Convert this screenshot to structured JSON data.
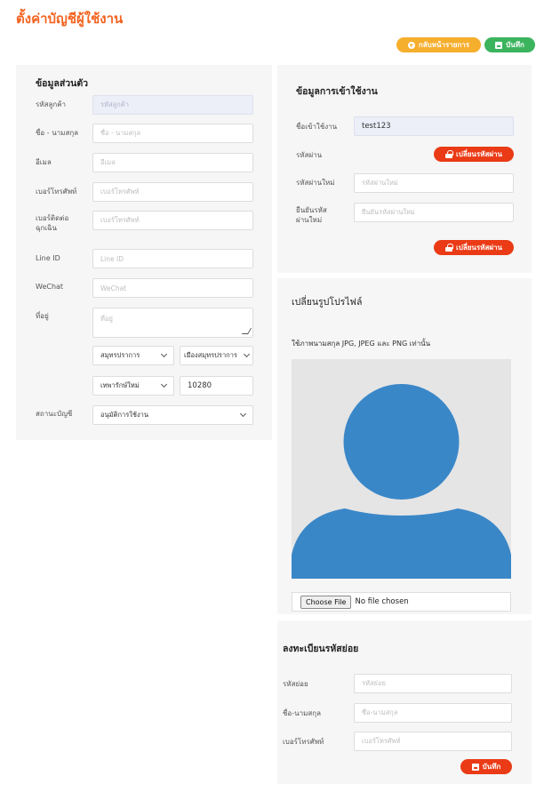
{
  "page": {
    "title": "ตั้งค่าบัญชีผู้ใช้งาน"
  },
  "toolbar": {
    "back_label": "กลับหน้ารายการ",
    "save_label": "บันทึก"
  },
  "personal": {
    "title": "ข้อมูลส่วนตัว",
    "customer_code": {
      "label": "รหัสลูกค้า",
      "placeholder": "รหัสลูกค้า"
    },
    "full_name": {
      "label": "ชื่อ - นามสกุล",
      "placeholder": "ชื่อ - นามสกุล"
    },
    "email": {
      "label": "อีเมล",
      "placeholder": "อีเมล"
    },
    "phone": {
      "label": "เบอร์โทรศัพท์",
      "placeholder": "เบอร์โทรศัพท์"
    },
    "emergency_phone": {
      "label_line1": "เบอร์ติดต่อ",
      "label_line2": "ฉุกเฉิน",
      "placeholder": "เบอร์โทรศัพท์"
    },
    "line_id": {
      "label": "Line ID",
      "placeholder": "Line ID"
    },
    "wechat": {
      "label": "WeChat",
      "placeholder": "WeChat"
    },
    "address": {
      "label": "ที่อยู่",
      "placeholder": "ที่อยู่",
      "province": "สมุทรปราการ",
      "district": "เมืองสมุทรปราการ",
      "subdistrict": "เทพารักษ์ใหม่",
      "postcode": "10280"
    },
    "account_status": {
      "label": "สถานะบัญชี",
      "value": "อนุมัติการใช้งาน"
    }
  },
  "login": {
    "title": "ข้อมูลการเข้าใช้งาน",
    "username": {
      "label": "ชื่อเข้าใช้งาน",
      "value": "test123"
    },
    "password": {
      "label": "รหัสผ่าน",
      "change_label": "เปลี่ยนรหัสผ่าน"
    },
    "new_password": {
      "label": "รหัสผ่านใหม่",
      "placeholder": "รหัสผ่านใหม่"
    },
    "confirm_password": {
      "label_line1": "ยืนยันรหัส",
      "label_line2": "ผ่านใหม่",
      "placeholder": "ยืนยันรหัสผ่านใหม่"
    },
    "change_password_label": "เปลี่ยนรหัสผ่าน"
  },
  "photo": {
    "title": "เปลี่ยนรูปโปรไฟล์",
    "hint": "ใช้ภาพนามสกุล JPG, JPEG และ PNG เท่านั้น",
    "file_button": "Choose File",
    "file_status": "No file chosen",
    "colors": {
      "avatar": "#3a87c8",
      "background": "#e5e5e5"
    }
  },
  "sub_code": {
    "title": "ลงทะเบียนรหัสย่อย",
    "code": {
      "label": "รหัสย่อย",
      "placeholder": "รหัสย่อย"
    },
    "name": {
      "label": "ชื่อ-นามสกุล",
      "placeholder": "ชื่อ-นามสกุล"
    },
    "phone": {
      "label": "เบอร์โทรศัพท์",
      "placeholder": "เบอร์โทรศัพท์"
    },
    "save_label": "บันทึก"
  },
  "colors": {
    "accent": "#f26522",
    "orange_button": "#f6ae2d",
    "green_button": "#3cb45e",
    "red_button": "#ea3b16"
  }
}
